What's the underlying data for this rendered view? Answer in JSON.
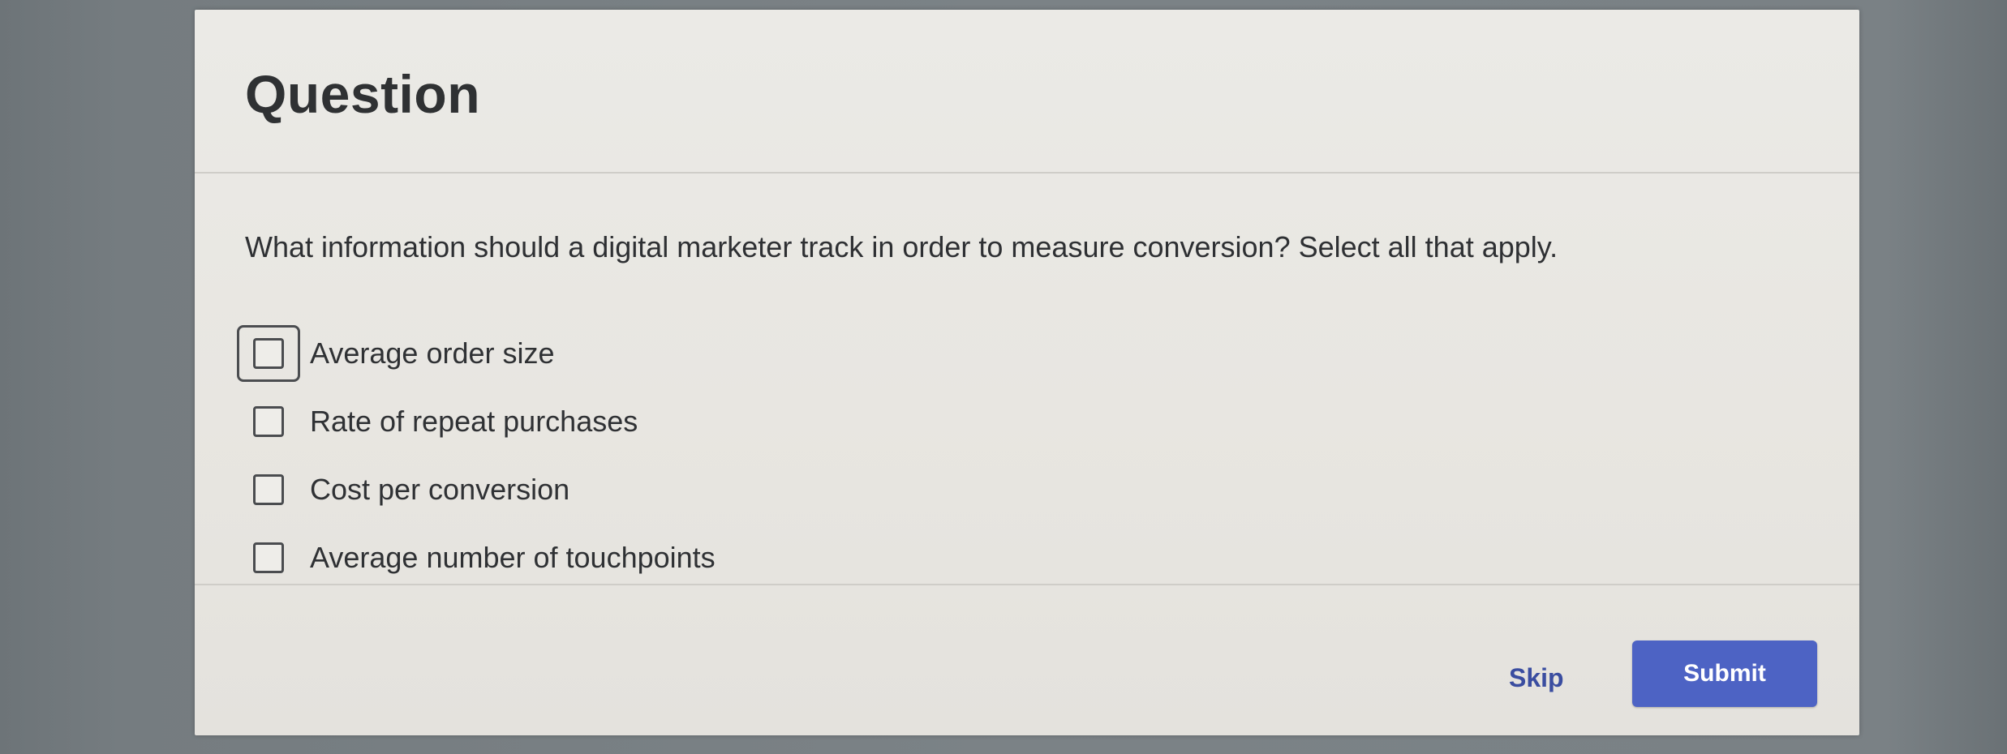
{
  "question": {
    "header": "Question",
    "prompt": "What information should a digital marketer track in order to measure conversion? Select all that apply.",
    "options": [
      {
        "label": "Average order size",
        "checked": false
      },
      {
        "label": "Rate of repeat purchases",
        "checked": false
      },
      {
        "label": "Cost per conversion",
        "checked": false
      },
      {
        "label": "Average number of touchpoints",
        "checked": false
      }
    ]
  },
  "footer": {
    "skip_label": "Skip",
    "submit_label": "Submit"
  },
  "colors": {
    "accent": "#4d63c4",
    "link": "#3a4da0"
  }
}
